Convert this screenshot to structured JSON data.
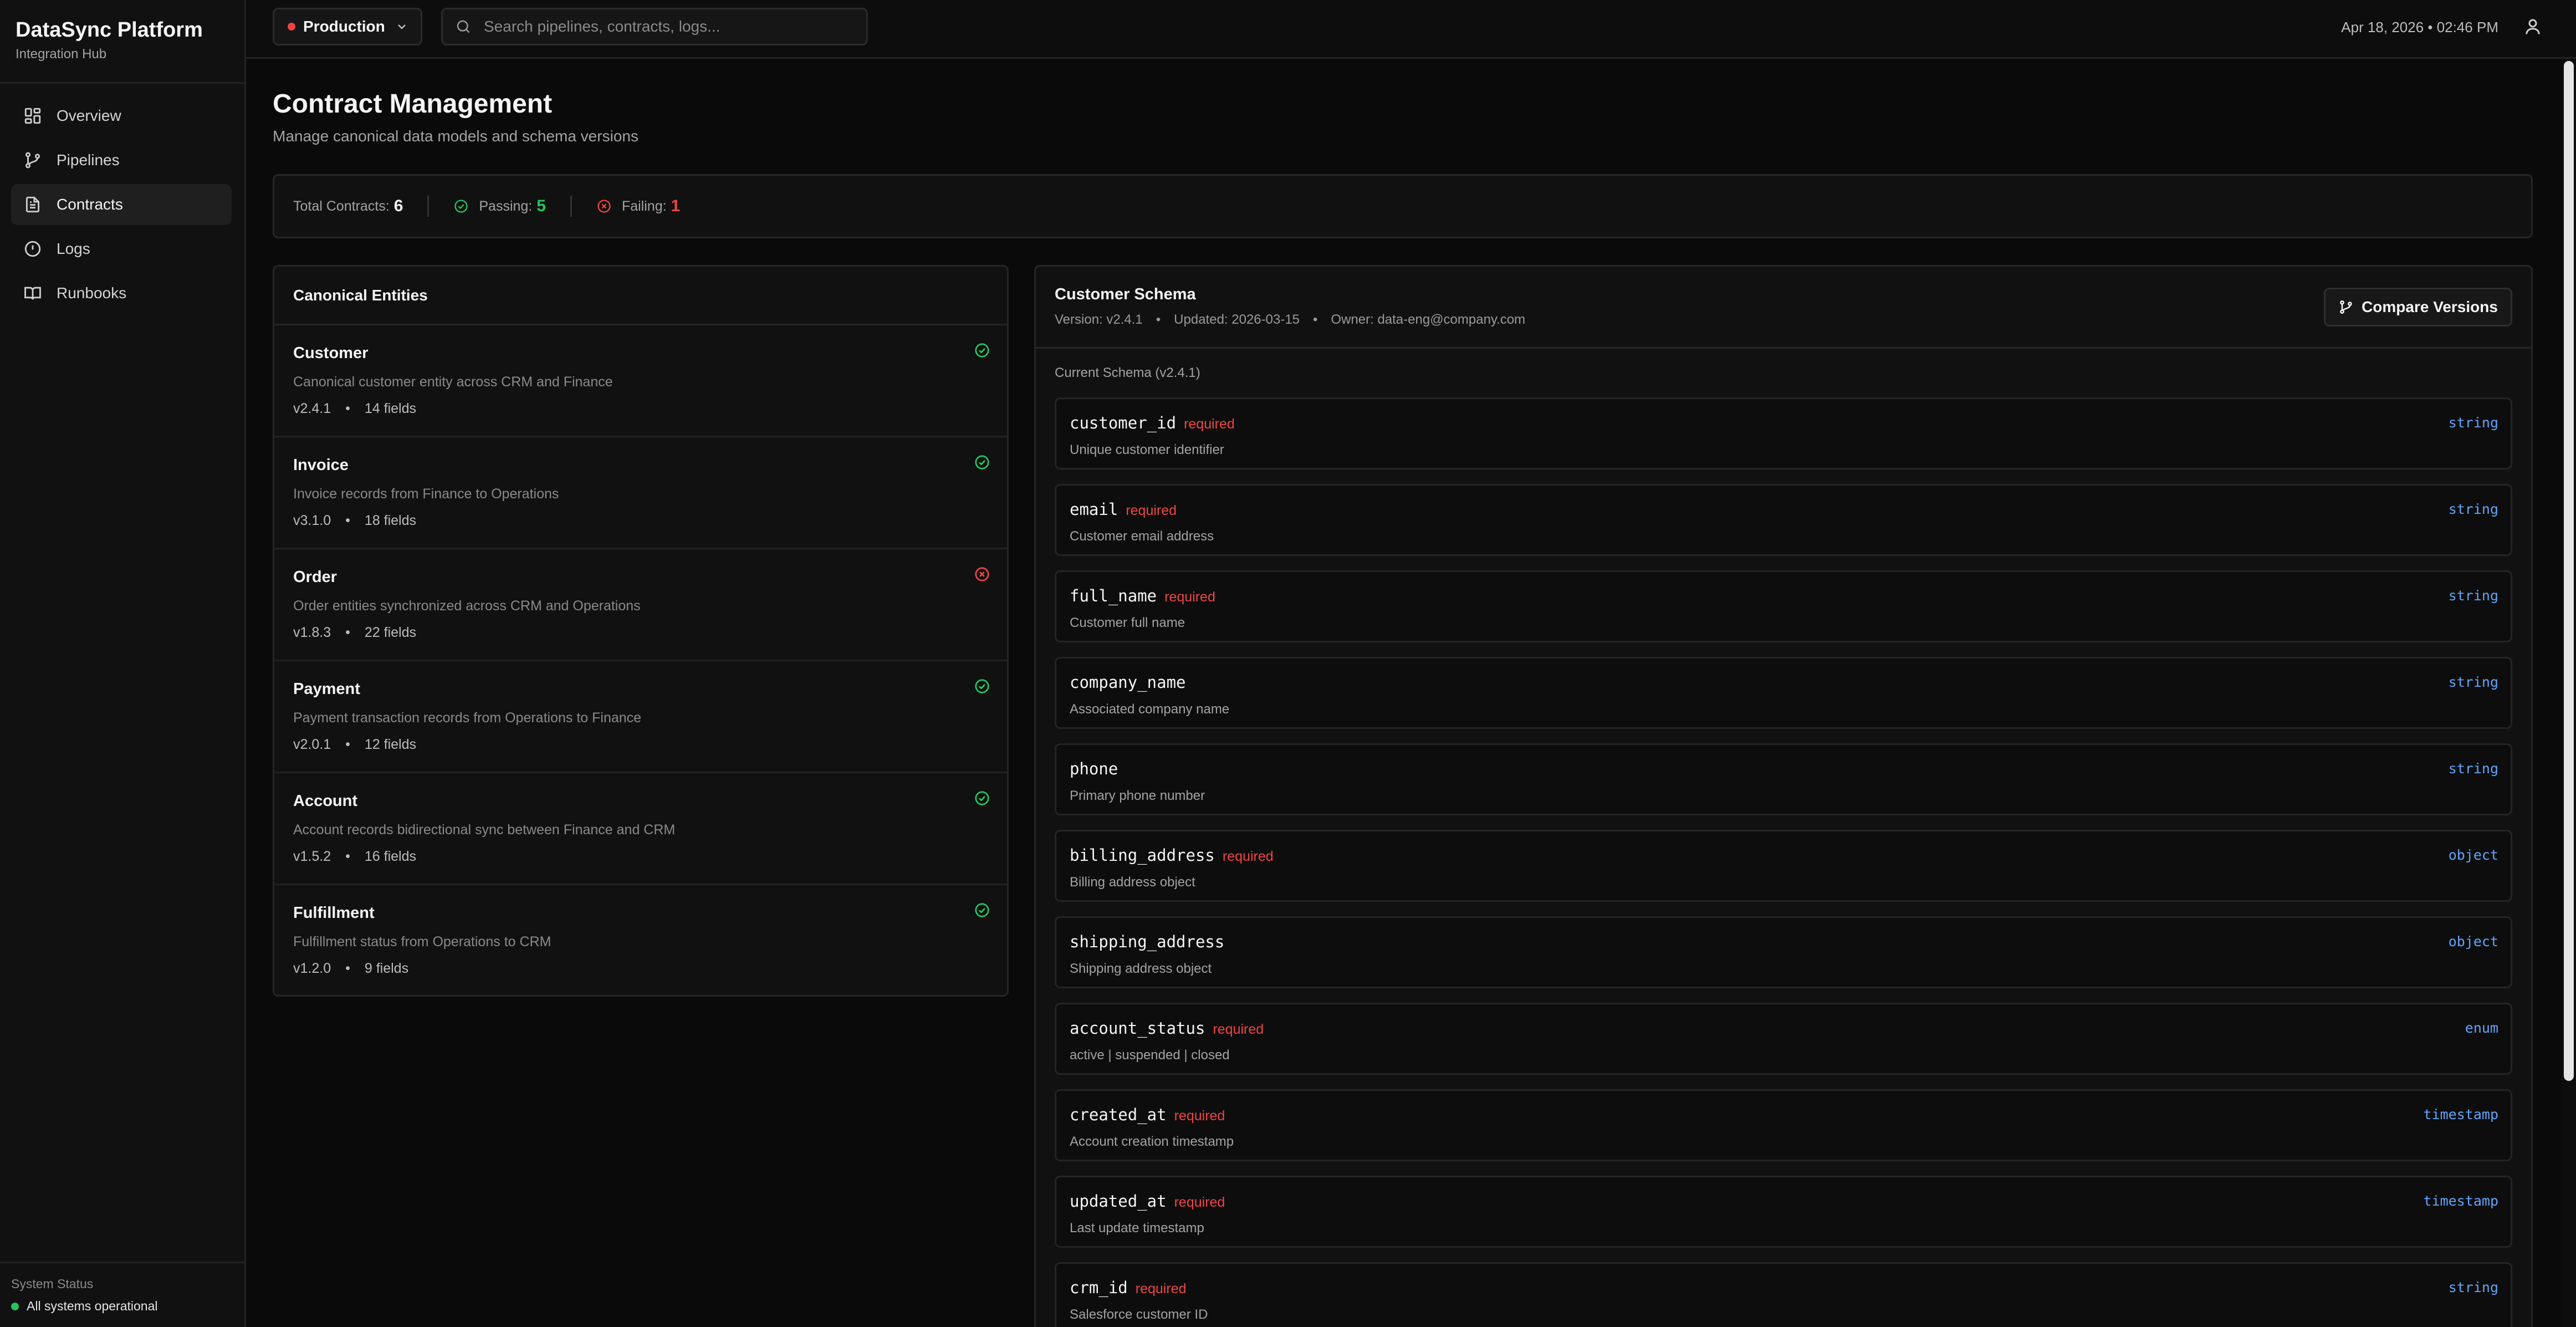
{
  "app": {
    "title": "DataSync Platform",
    "subtitle": "Integration Hub"
  },
  "sidebar": {
    "items": [
      {
        "label": "Overview",
        "icon": "grid-icon",
        "active": false
      },
      {
        "label": "Pipelines",
        "icon": "git-branch-icon",
        "active": false
      },
      {
        "label": "Contracts",
        "icon": "file-text-icon",
        "active": true
      },
      {
        "label": "Logs",
        "icon": "alert-circle-icon",
        "active": false
      },
      {
        "label": "Runbooks",
        "icon": "book-open-icon",
        "active": false
      }
    ],
    "status_label": "System Status",
    "status_text": "All systems operational"
  },
  "topbar": {
    "environment": "Production",
    "search_placeholder": "Search pipelines, contracts, logs...",
    "timestamp": "Apr 18, 2026 • 02:46 PM"
  },
  "page": {
    "title": "Contract Management",
    "subtitle": "Manage canonical data models and schema versions"
  },
  "stats": {
    "total_label": "Total Contracts:",
    "total_value": "6",
    "passing_label": "Passing:",
    "passing_value": "5",
    "failing_label": "Failing:",
    "failing_value": "1"
  },
  "entities": {
    "title": "Canonical Entities",
    "items": [
      {
        "name": "Customer",
        "desc": "Canonical customer entity across CRM and Finance",
        "version": "v2.4.1",
        "fields": "14 fields",
        "status": "passing"
      },
      {
        "name": "Invoice",
        "desc": "Invoice records from Finance to Operations",
        "version": "v3.1.0",
        "fields": "18 fields",
        "status": "passing"
      },
      {
        "name": "Order",
        "desc": "Order entities synchronized across CRM and Operations",
        "version": "v1.8.3",
        "fields": "22 fields",
        "status": "failing"
      },
      {
        "name": "Payment",
        "desc": "Payment transaction records from Operations to Finance",
        "version": "v2.0.1",
        "fields": "12 fields",
        "status": "passing"
      },
      {
        "name": "Account",
        "desc": "Account records bidirectional sync between Finance and CRM",
        "version": "v1.5.2",
        "fields": "16 fields",
        "status": "passing"
      },
      {
        "name": "Fulfillment",
        "desc": "Fulfillment status from Operations to CRM",
        "version": "v1.2.0",
        "fields": "9 fields",
        "status": "passing"
      }
    ]
  },
  "schema": {
    "title": "Customer Schema",
    "version": "Version: v2.4.1",
    "updated": "Updated: 2026-03-15",
    "owner": "Owner: data-eng@company.com",
    "compare_label": "Compare Versions",
    "current_label": "Current Schema (v2.4.1)",
    "required_label": "required",
    "fields": [
      {
        "name": "customer_id",
        "required": true,
        "desc": "Unique customer identifier",
        "type": "string"
      },
      {
        "name": "email",
        "required": true,
        "desc": "Customer email address",
        "type": "string"
      },
      {
        "name": "full_name",
        "required": true,
        "desc": "Customer full name",
        "type": "string"
      },
      {
        "name": "company_name",
        "required": false,
        "desc": "Associated company name",
        "type": "string"
      },
      {
        "name": "phone",
        "required": false,
        "desc": "Primary phone number",
        "type": "string"
      },
      {
        "name": "billing_address",
        "required": true,
        "desc": "Billing address object",
        "type": "object"
      },
      {
        "name": "shipping_address",
        "required": false,
        "desc": "Shipping address object",
        "type": "object"
      },
      {
        "name": "account_status",
        "required": true,
        "desc": "active | suspended | closed",
        "type": "enum"
      },
      {
        "name": "created_at",
        "required": true,
        "desc": "Account creation timestamp",
        "type": "timestamp"
      },
      {
        "name": "updated_at",
        "required": true,
        "desc": "Last update timestamp",
        "type": "timestamp"
      },
      {
        "name": "crm_id",
        "required": true,
        "desc": "Salesforce customer ID",
        "type": "string"
      }
    ]
  },
  "colors": {
    "passing": "#22c55e",
    "failing": "#ef4444",
    "type": "#60a5fa"
  }
}
